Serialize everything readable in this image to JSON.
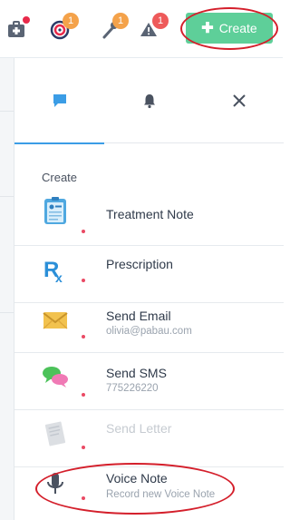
{
  "header": {
    "badges": {
      "goals": "1",
      "tools": "1",
      "alerts": "1"
    },
    "create_label": "Create",
    "icons": [
      "medical-kit-icon",
      "target-icon",
      "wrench-icon",
      "warning-icon"
    ]
  },
  "panel": {
    "tabs": [
      {
        "name": "chat",
        "icon": "chat-bubble-icon",
        "active": true
      },
      {
        "name": "notifications",
        "icon": "bell-icon",
        "active": false
      },
      {
        "name": "close",
        "icon": "close-icon",
        "active": false
      }
    ],
    "section_label": "Create",
    "items": [
      {
        "title": "Treatment Note",
        "subtitle": "",
        "icon": "treatment-note-icon",
        "enabled": true
      },
      {
        "title": "Prescription",
        "subtitle": "",
        "icon": "prescription-icon",
        "enabled": true
      },
      {
        "title": "Send Email",
        "subtitle": "olivia@pabau.com",
        "icon": "envelope-icon",
        "enabled": true
      },
      {
        "title": "Send SMS",
        "subtitle": "775226220",
        "icon": "sms-bubbles-icon",
        "enabled": true
      },
      {
        "title": "Send Letter",
        "subtitle": "",
        "icon": "letter-icon",
        "enabled": false
      },
      {
        "title": "Voice Note",
        "subtitle": "Record new Voice Note",
        "icon": "microphone-icon",
        "enabled": true
      }
    ]
  },
  "colors": {
    "accent_green": "#5ecf99",
    "accent_blue": "#3b9de6",
    "annotation_red": "#d41f2b",
    "badge_orange": "#f4a24a",
    "badge_red": "#ee5a5a"
  }
}
